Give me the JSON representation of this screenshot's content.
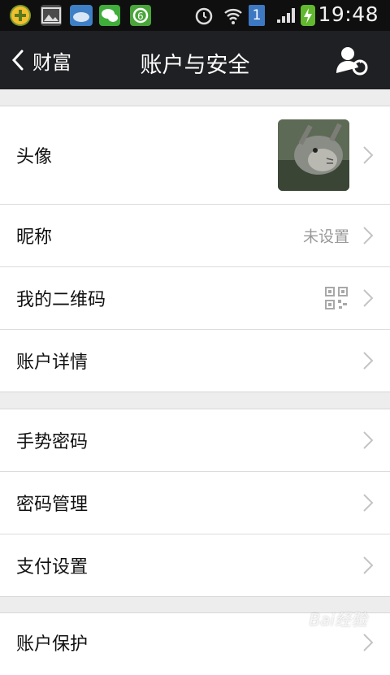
{
  "status_bar": {
    "time": "19:48",
    "sim_slot": "1",
    "icons": [
      "app-icon",
      "gallery-icon",
      "weather-icon",
      "wechat-icon",
      "sync-icon",
      "alarm-icon",
      "wifi-icon",
      "sim-icon",
      "signal-icon",
      "battery-charging-icon"
    ]
  },
  "header": {
    "back_label": "财富",
    "title": "账户与安全",
    "action_icon": "switch-account-icon"
  },
  "groups": [
    {
      "rows": [
        {
          "label": "头像",
          "value": "",
          "type": "avatar"
        },
        {
          "label": "昵称",
          "value": "未设置",
          "type": "text"
        },
        {
          "label": "我的二维码",
          "value": "",
          "type": "qr"
        },
        {
          "label": "账户详情",
          "value": "",
          "type": "plain"
        }
      ]
    },
    {
      "rows": [
        {
          "label": "手势密码",
          "value": "",
          "type": "plain"
        },
        {
          "label": "密码管理",
          "value": "",
          "type": "plain"
        },
        {
          "label": "支付设置",
          "value": "",
          "type": "plain"
        }
      ]
    },
    {
      "rows": [
        {
          "label": "账户保护",
          "value": "",
          "type": "plain"
        }
      ]
    }
  ],
  "watermark": "Bai经验"
}
